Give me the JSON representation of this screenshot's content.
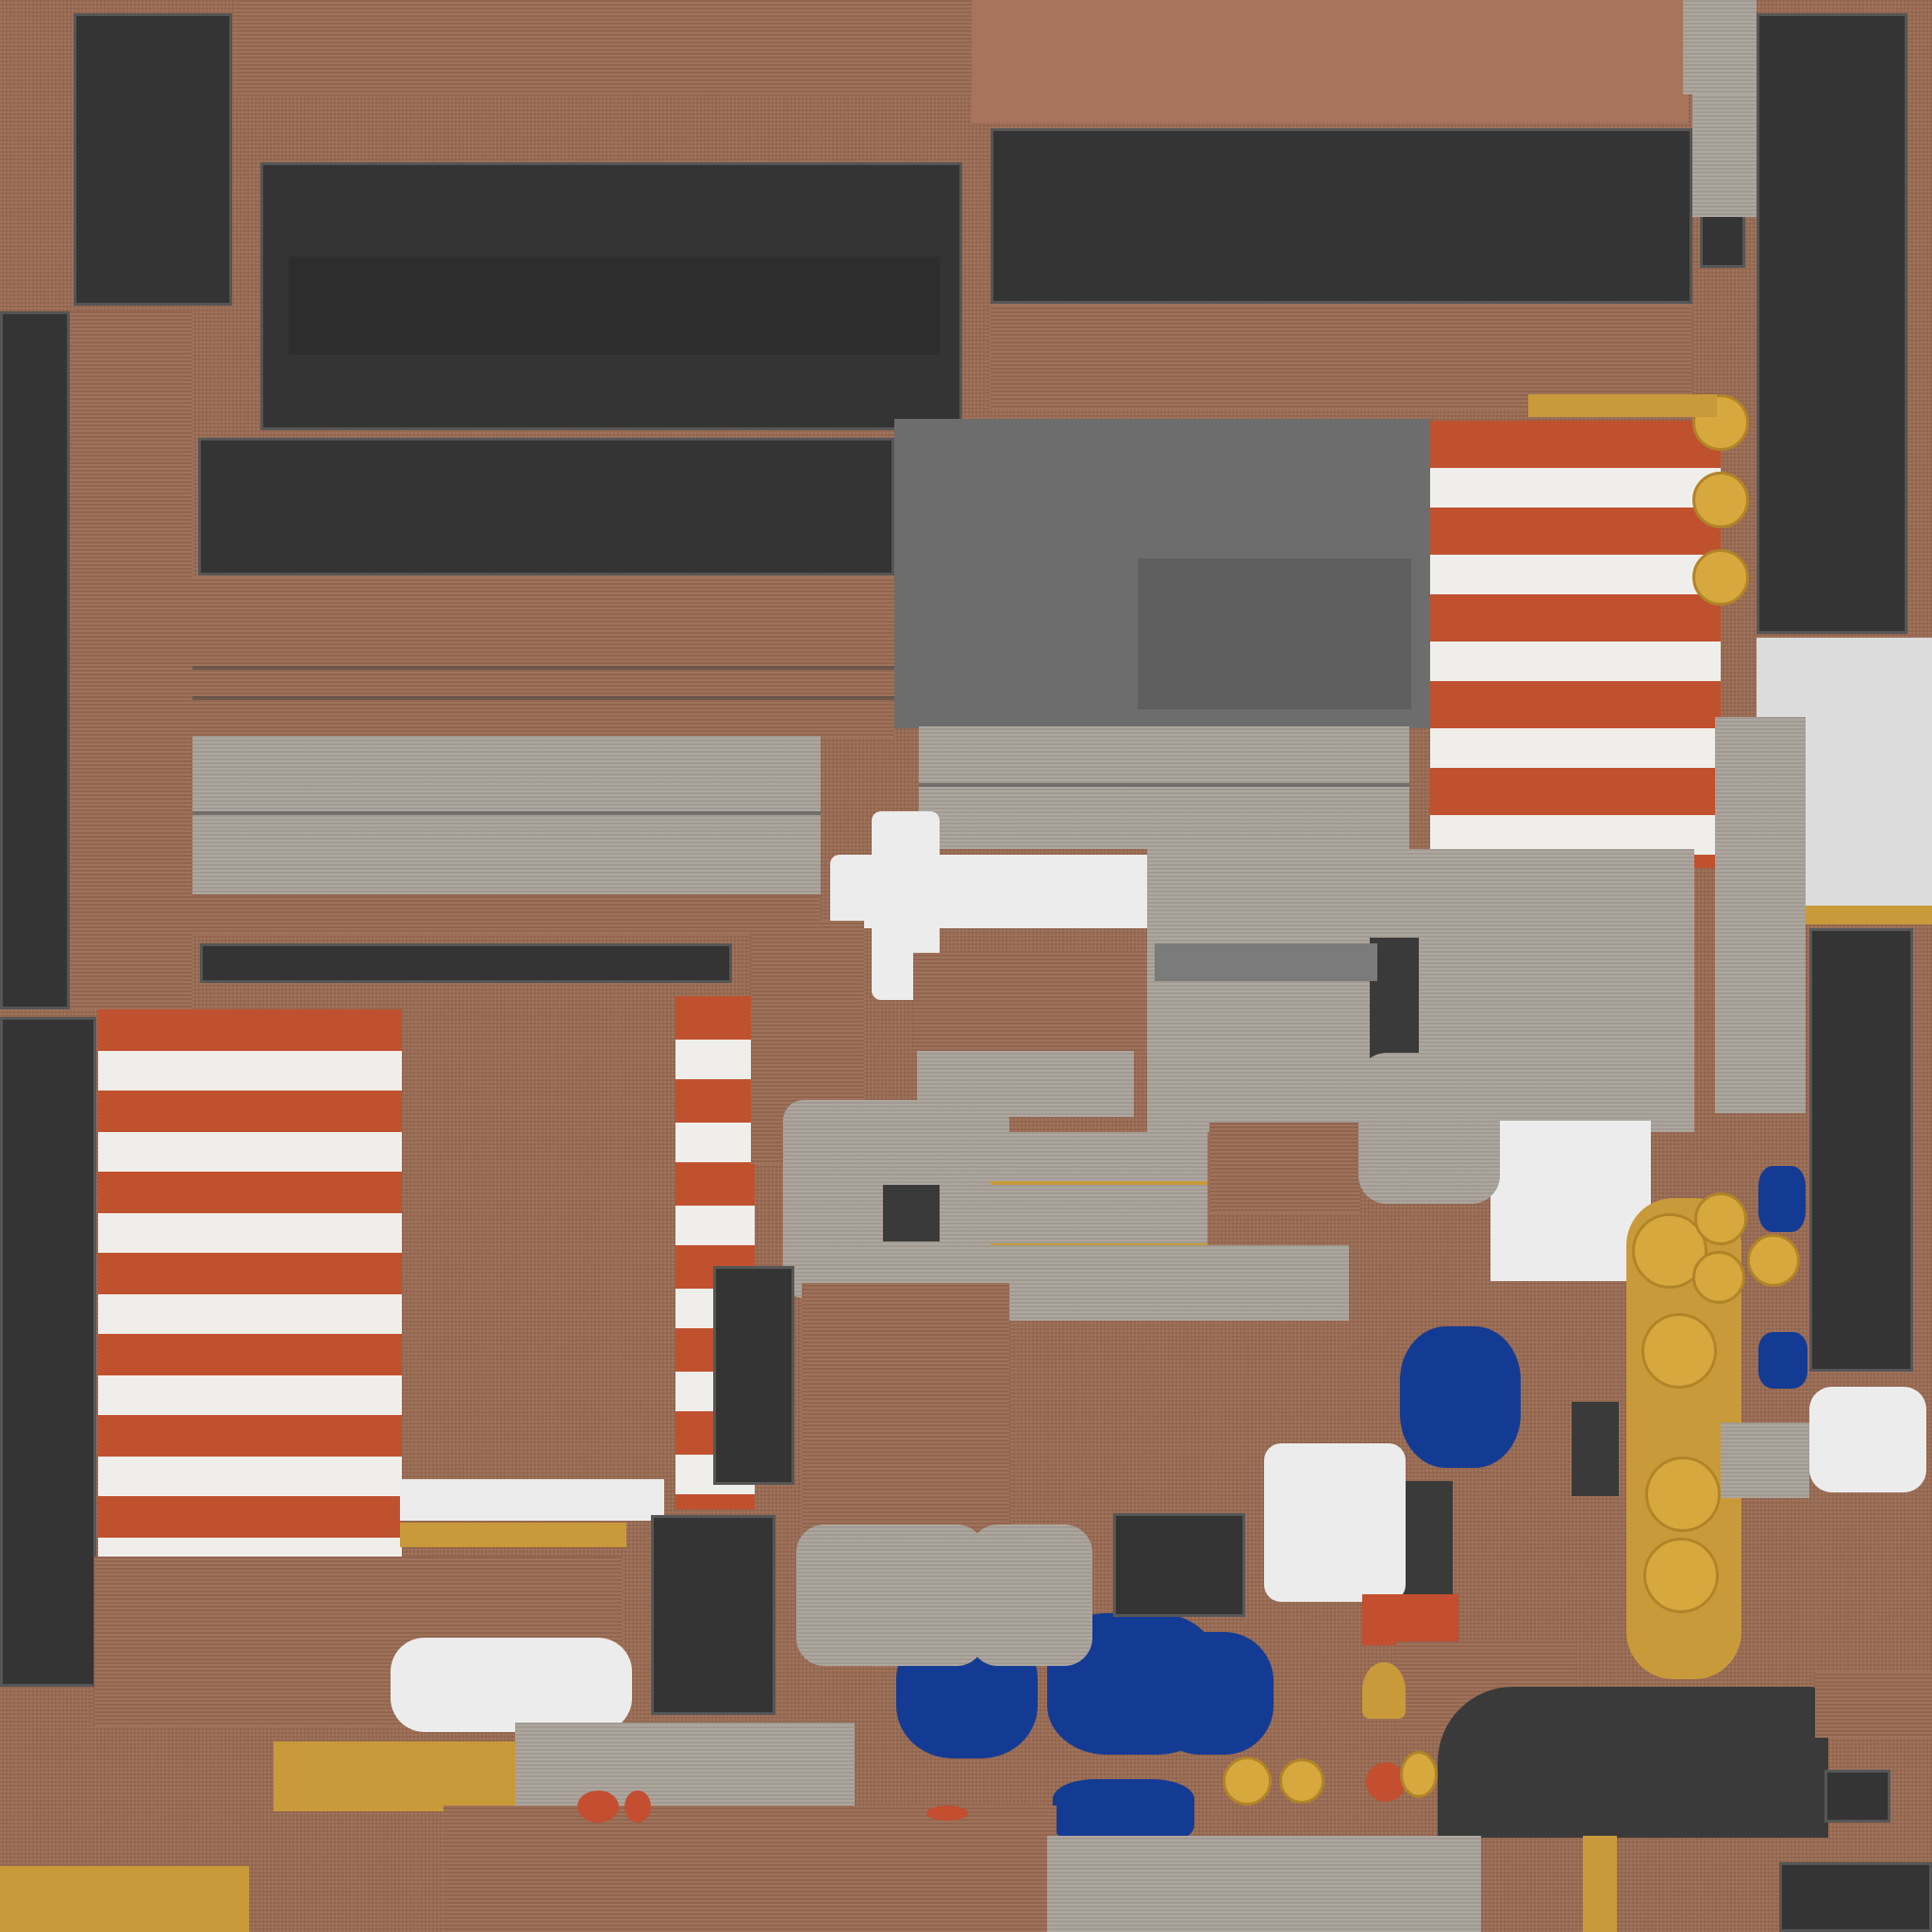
{
  "image": {
    "kind": "texture-atlas",
    "description_text": "",
    "colors": {
      "wood": "#9a6a52",
      "dark_panel": "#343434",
      "grey": "#a9a29a",
      "white": "#ececec",
      "blue": "#143b94",
      "gold": "#c99a3a",
      "orange_red": "#c0512f"
    }
  }
}
